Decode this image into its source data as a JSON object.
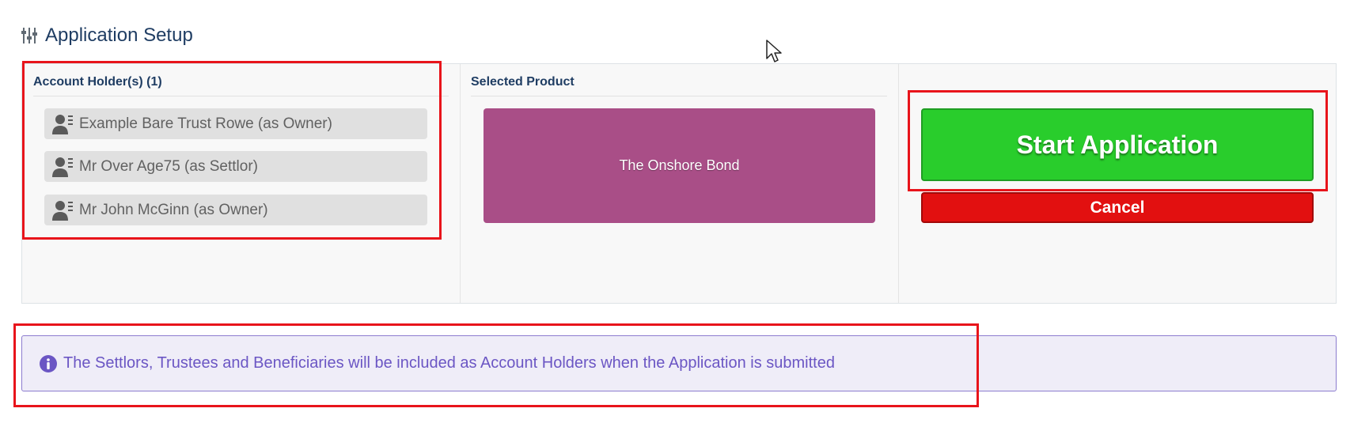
{
  "header": {
    "title": "Application Setup",
    "icon": "sliders-icon"
  },
  "account_holders": {
    "heading": "Account Holder(s) (1)",
    "items": [
      {
        "label": "Example Bare Trust Rowe (as Owner)",
        "icon": "person-card-icon"
      },
      {
        "label": "Mr Over Age75 (as Settlor)",
        "icon": "person-card-icon"
      },
      {
        "label": "Mr John McGinn (as Owner)",
        "icon": "person-card-icon"
      }
    ]
  },
  "selected_product": {
    "heading": "Selected Product",
    "product_name": "The Onshore Bond",
    "tile_color": "#a94e87"
  },
  "actions": {
    "start_label": "Start Application",
    "cancel_label": "Cancel",
    "start_color": "#29cd2c",
    "cancel_color": "#e21010"
  },
  "info": {
    "icon": "info-circle-icon",
    "text": "The Settlors, Trustees and Beneficiaries will be included as Account Holders when the Application is submitted"
  },
  "colors": {
    "title": "#1f3d63",
    "info_text": "#6b56c4",
    "highlight": "#e8141b"
  }
}
